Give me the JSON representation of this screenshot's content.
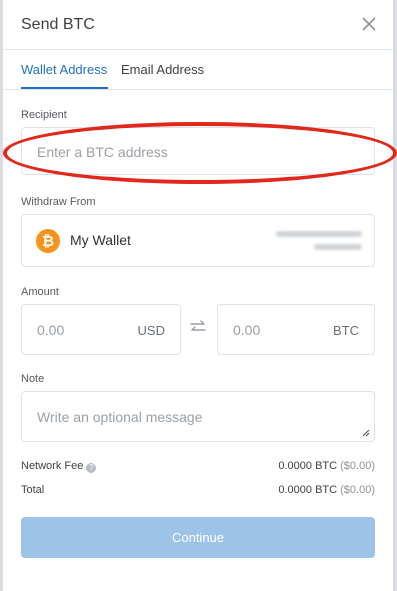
{
  "header": {
    "title": "Send BTC",
    "close_icon": "close-icon"
  },
  "tabs": [
    {
      "label": "Wallet Address",
      "active": true
    },
    {
      "label": "Email Address",
      "active": false
    }
  ],
  "recipient": {
    "label": "Recipient",
    "placeholder": "Enter a BTC address"
  },
  "withdraw": {
    "label": "Withdraw From",
    "wallet_name": "My Wallet",
    "icon": "bitcoin-icon"
  },
  "amount": {
    "label": "Amount",
    "usd_value": "0.00",
    "usd_unit": "USD",
    "btc_value": "0.00",
    "btc_unit": "BTC",
    "swap_icon": "swap-arrows-icon"
  },
  "note": {
    "label": "Note",
    "placeholder": "Write an optional message"
  },
  "fees": {
    "network_fee_label": "Network Fee",
    "network_fee_btc": "0.0000 BTC",
    "network_fee_usd": "($0.00)",
    "total_label": "Total",
    "total_btc": "0.0000 BTC",
    "total_usd": "($0.00)"
  },
  "continue_label": "Continue",
  "colors": {
    "accent": "#1f6fc6",
    "button": "#9cc3e8",
    "annotation": "#e2271b",
    "bitcoin": "#f7931a"
  }
}
